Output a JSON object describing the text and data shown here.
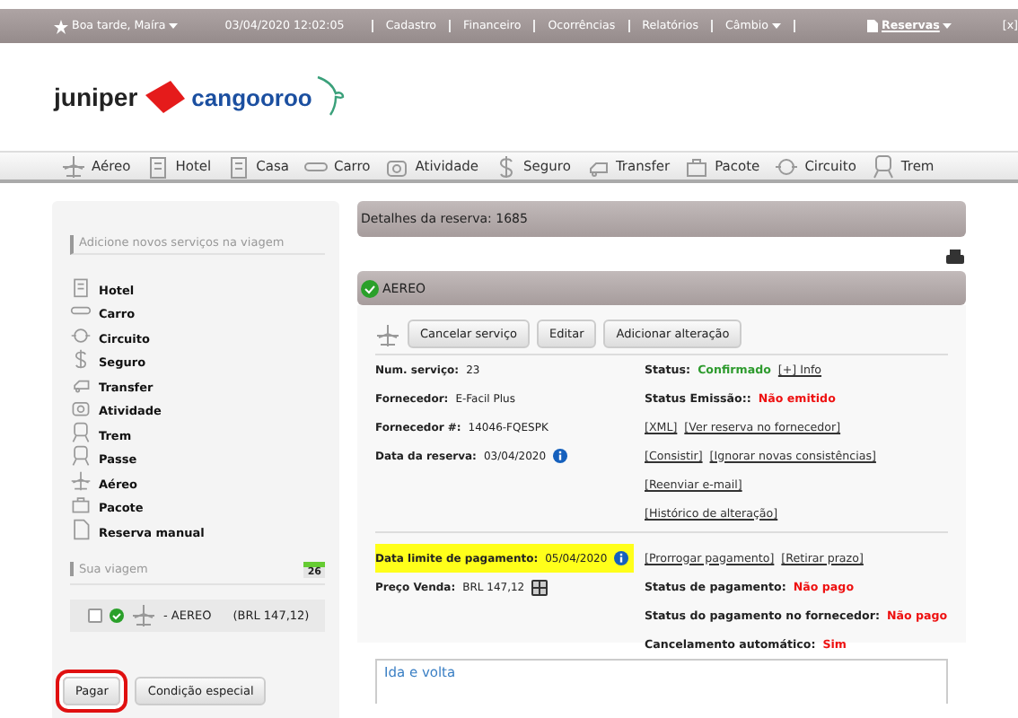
{
  "top_bar": {
    "greeting": "Boa tarde, Maíra",
    "datetime": "03/04/2020 12:02:05",
    "menu": [
      {
        "label": "Cadastro",
        "dropdown": false
      },
      {
        "label": "Financeiro",
        "dropdown": false
      },
      {
        "label": "Ocorrências",
        "dropdown": false
      },
      {
        "label": "Relatórios",
        "dropdown": false
      },
      {
        "label": "Câmbio",
        "dropdown": true
      }
    ],
    "reservas": "Reservas",
    "close": "[x]"
  },
  "logo": {
    "brand": "juniper",
    "partner": "cangooroo"
  },
  "nav": [
    {
      "label": "Aéreo"
    },
    {
      "label": "Hotel"
    },
    {
      "label": "Casa"
    },
    {
      "label": "Carro"
    },
    {
      "label": "Atividade"
    },
    {
      "label": "Seguro"
    },
    {
      "label": "Transfer"
    },
    {
      "label": "Pacote"
    },
    {
      "label": "Circuito"
    },
    {
      "label": "Trem"
    }
  ],
  "sidebar": {
    "title": "Adicione novos serviços na viagem",
    "services": [
      {
        "label": "Hotel"
      },
      {
        "label": "Carro"
      },
      {
        "label": "Circuito"
      },
      {
        "label": "Seguro"
      },
      {
        "label": "Transfer"
      },
      {
        "label": "Atividade"
      },
      {
        "label": "Trem"
      },
      {
        "label": "Passe"
      },
      {
        "label": "Aéreo"
      },
      {
        "label": "Pacote"
      },
      {
        "label": "Reserva manual"
      }
    ],
    "trip_title": "Sua viagem",
    "calendar_day": "26",
    "trip_items": [
      {
        "checked": false,
        "confirmed": true,
        "label": "- AEREO",
        "price": "(BRL 147,12)"
      }
    ],
    "buttons": [
      {
        "label": "Pagar",
        "highlighted": true
      },
      {
        "label": "Condição especial",
        "highlighted": false
      }
    ]
  },
  "main": {
    "title": "Detalhes da reserva: 1685",
    "section": {
      "title": "AEREO",
      "confirmed": true,
      "buttons": [
        "Cancelar serviço",
        "Editar",
        "Adicionar alteração"
      ],
      "upper_left": [
        {
          "kind": "plain",
          "label": "Num. serviço:",
          "value": "23",
          "highlighted": false
        },
        {
          "kind": "plain",
          "label": "Fornecedor:",
          "value": "E-Facil Plus",
          "highlighted": false
        },
        {
          "kind": "plain",
          "label": "Fornecedor #:",
          "value": "14046-FQESPK",
          "highlighted": false
        },
        {
          "kind": "info",
          "label": "Data da reserva:",
          "value": "03/04/2020",
          "highlighted": false
        }
      ],
      "upper_right": [
        {
          "kind": "field",
          "label": "Status:",
          "value": "Confirmado",
          "color": "#2e9b2e",
          "links": [
            "[+] Info"
          ]
        },
        {
          "kind": "field",
          "label": "Status Emissão::",
          "value": "Não emitido",
          "color": "#ee1111"
        },
        {
          "kind": "links",
          "links": [
            "[XML]",
            "[Ver reserva no fornecedor]"
          ]
        },
        {
          "kind": "links",
          "links": [
            "[Consistir]",
            "[Ignorar novas consistências]"
          ]
        },
        {
          "kind": "links",
          "links": [
            "[Reenviar e-mail]"
          ]
        },
        {
          "kind": "links",
          "links": [
            "[Histórico de alteração]"
          ]
        }
      ],
      "lower_left": [
        {
          "kind": "info",
          "label": "Data limite de pagamento:",
          "value": "05/04/2020",
          "highlighted": true
        },
        {
          "kind": "calculator",
          "label": "Preço Venda:",
          "value": "BRL 147,12",
          "highlighted": false
        }
      ],
      "lower_right": [
        {
          "kind": "links",
          "links": [
            "[Prorrogar pagamento]",
            "[Retirar prazo]"
          ]
        },
        {
          "kind": "field",
          "label": "Status de pagamento:",
          "value": "Não pago",
          "color": "#ee1111"
        },
        {
          "kind": "field",
          "label": "Status do pagamento no fornecedor:",
          "value": "Não pago",
          "color": "#ee1111"
        },
        {
          "kind": "field",
          "label": "Cancelamento automático:",
          "value": "Sim",
          "color": "#ee1111"
        }
      ],
      "route_title": "Ida e volta"
    }
  }
}
